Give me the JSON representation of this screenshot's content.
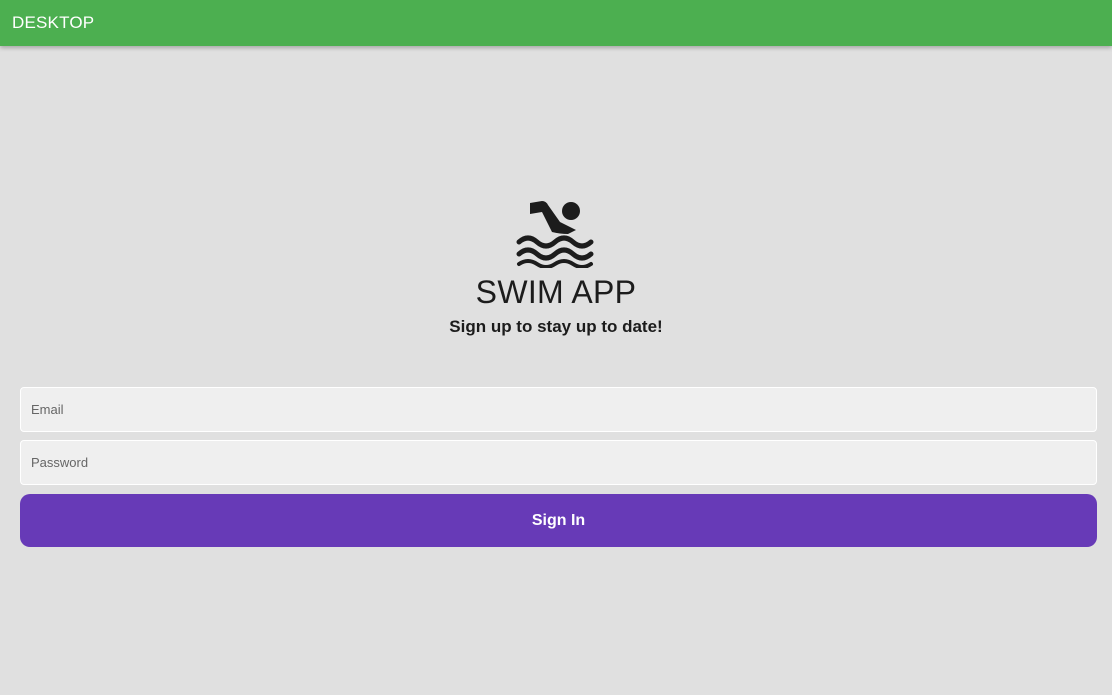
{
  "appbar": {
    "title": "DESKTOP",
    "color": "#4caf50"
  },
  "hero": {
    "icon": "swimmer-icon",
    "title": "SWIM APP",
    "subtitle": "Sign up to stay up to date!"
  },
  "form": {
    "email": {
      "placeholder": "Email",
      "value": ""
    },
    "password": {
      "placeholder": "Password",
      "value": ""
    },
    "submit_label": "Sign In",
    "submit_color": "#673ab7"
  },
  "background_color": "#e0e0e0"
}
